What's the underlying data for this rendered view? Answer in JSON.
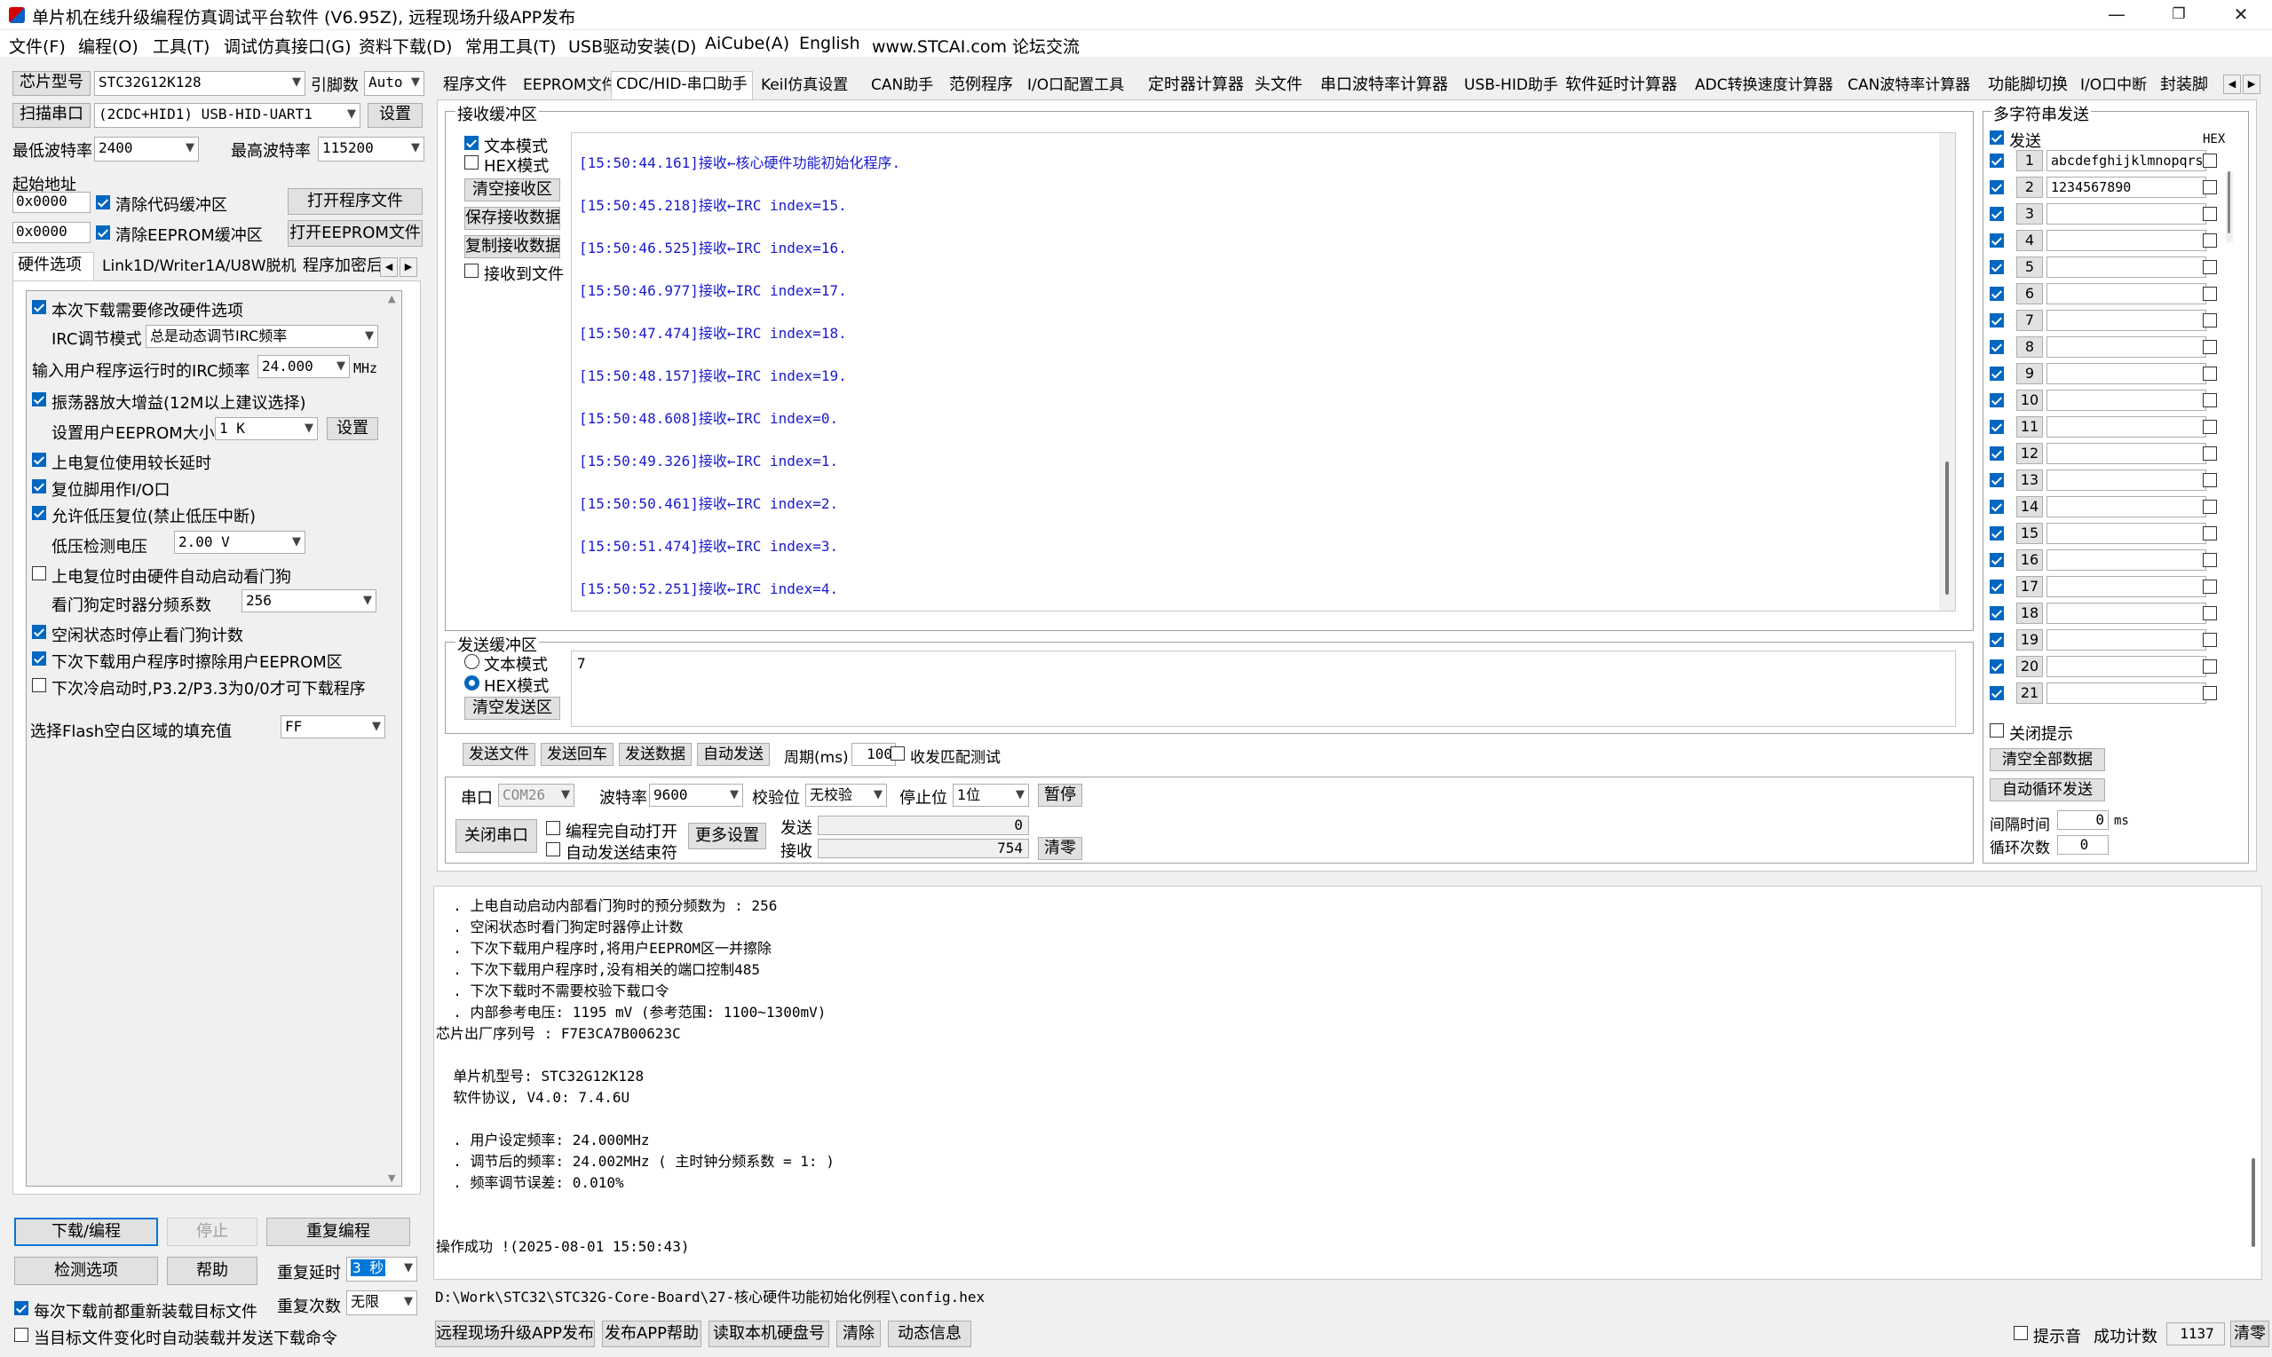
{
  "window": {
    "title": "单片机在线升级编程仿真调试平台软件 (V6.95Z), 远程现场升级APP发布",
    "min": "—",
    "max": "❐",
    "close": "✕"
  },
  "menu": [
    "文件(F)",
    "编程(O)",
    "工具(T)",
    "调试仿真接口(G)",
    "资料下载(D)",
    "常用工具(T)",
    "USB驱动安装(D)",
    "AiCube(A)",
    "English",
    "www.STCAI.com 论坛交流"
  ],
  "left": {
    "chip_label": "芯片型号",
    "chip_value": "STC32G12K128",
    "pins_label": "引脚数",
    "pins_value": "Auto",
    "scan_btn": "扫描串口",
    "port_value": "(2CDC+HID1) USB-HID-UART1",
    "set_btn": "设置",
    "min_baud_label": "最低波特率",
    "min_baud_value": "2400",
    "max_baud_label": "最高波特率",
    "max_baud_value": "115200",
    "start_addr_label": "起始地址",
    "addr1": "0x0000",
    "addr2": "0x0000",
    "clear_code_label": "清除代码缓冲区",
    "clear_eeprom_label": "清除EEPROM缓冲区",
    "open_prog_btn": "打开程序文件",
    "open_eeprom_btn": "打开EEPROM文件",
    "tabs": [
      "硬件选项",
      "Link1D/Writer1A/U8W脱机",
      "程序加密后"
    ],
    "hw": {
      "opt_modify": "本次下载需要修改硬件选项",
      "irc_mode_label": "IRC调节模式",
      "irc_mode_value": "总是动态调节IRC频率",
      "irc_freq_label": "输入用户程序运行时的IRC频率",
      "irc_freq_value": "24.000",
      "irc_freq_unit": "MHz",
      "osc_gain": "振荡器放大增益(12M以上建议选择)",
      "eeprom_size_label": "设置用户EEPROM大小",
      "eeprom_size_value": "1   K",
      "eeprom_set_btn": "设置",
      "long_delay": "上电复位使用较长延时",
      "reset_io": "复位脚用作I/O口",
      "lvr": "允许低压复位(禁止低压中断)",
      "lvd_label": "低压检测电压",
      "lvd_value": "2.00 V",
      "wdt_auto": "上电复位时由硬件自动启动看门狗",
      "wdt_div_label": "看门狗定时器分频系数",
      "wdt_div_value": "256",
      "idle_stop_wdt": "空闲状态时停止看门狗计数",
      "erase_eeprom": "下次下载用户程序时擦除用户EEPROM区",
      "p32_cold": "下次冷启动时,P3.2/P3.3为0/0才可下载程序",
      "flash_fill_label": "选择Flash空白区域的填充值",
      "flash_fill_value": "FF"
    },
    "download_btn": "下载/编程",
    "stop_btn": "停止",
    "reprogram_btn": "重复编程",
    "check_btn": "检测选项",
    "help_btn": "帮助",
    "repeat_delay_label": "重复延时",
    "repeat_delay_value": "3 秒",
    "repeat_count_label": "重复次数",
    "repeat_count_value": "无限",
    "reload_label": "每次下载前都重新装载目标文件",
    "auto_load_label": "当目标文件变化时自动装载并发送下载命令"
  },
  "tabs": [
    "程序文件",
    "EEPROM文件",
    "CDC/HID-串口助手",
    "Keil仿真设置",
    "CAN助手",
    "范例程序",
    "I/O口配置工具",
    "定时器计算器",
    "头文件",
    "串口波特率计算器",
    "USB-HID助手",
    "软件延时计算器",
    "ADC转换速度计算器",
    "CAN波特率计算器",
    "功能脚切换",
    "I/O口中断",
    "封装脚"
  ],
  "recv": {
    "group_label": "接收缓冲区",
    "text_mode": "文本模式",
    "hex_mode": "HEX模式",
    "clear_btn": "清空接收区",
    "save_btn": "保存接收数据",
    "copy_btn": "复制接收数据",
    "to_file": "接收到文件",
    "lines": [
      "[15:50:44.161]接收←核心硬件功能初始化程序.",
      "[15:50:45.218]接收←IRC index=15.",
      "[15:50:46.525]接收←IRC index=16.",
      "[15:50:46.977]接收←IRC index=17.",
      "[15:50:47.474]接收←IRC index=18.",
      "[15:50:48.157]接收←IRC index=19.",
      "[15:50:48.608]接收←IRC index=0.",
      "[15:50:49.326]接收←IRC index=1.",
      "[15:50:50.461]接收←IRC index=2.",
      "[15:50:51.474]接收←IRC index=3.",
      "[15:50:52.251]接收←IRC index=4."
    ]
  },
  "send": {
    "group_label": "发送缓冲区",
    "text_mode": "文本模式",
    "hex_mode": "HEX模式",
    "clear_btn": "清空发送区",
    "content": "7",
    "send_file_btn": "发送文件",
    "send_cr_btn": "发送回车",
    "send_data_btn": "发送数据",
    "auto_send_btn": "自动发送",
    "period_label": "周期(ms)",
    "period_value": "100",
    "match_test": "收发匹配测试"
  },
  "serial": {
    "port_label": "串口",
    "port_value": "COM26",
    "baud_label": "波特率",
    "baud_value": "9600",
    "parity_label": "校验位",
    "parity_value": "无校验",
    "stop_label": "停止位",
    "stop_value": "1位",
    "pause_btn": "暂停",
    "close_btn": "关闭串口",
    "auto_open": "编程完自动打开",
    "auto_end": "自动发送结束符",
    "more_btn": "更多设置",
    "tx_label": "发送",
    "tx_count": "0",
    "rx_label": "接收",
    "rx_count": "754",
    "clear_btn": "清零"
  },
  "multi": {
    "group_label": "多字符串发送",
    "send_label": "发送",
    "hex_label": "HEX",
    "rows": [
      {
        "n": "1",
        "v": "abcdefghijklmnopqrs"
      },
      {
        "n": "2",
        "v": "1234567890"
      },
      {
        "n": "3",
        "v": ""
      },
      {
        "n": "4",
        "v": ""
      },
      {
        "n": "5",
        "v": ""
      },
      {
        "n": "6",
        "v": ""
      },
      {
        "n": "7",
        "v": ""
      },
      {
        "n": "8",
        "v": ""
      },
      {
        "n": "9",
        "v": ""
      },
      {
        "n": "10",
        "v": ""
      },
      {
        "n": "11",
        "v": ""
      },
      {
        "n": "12",
        "v": ""
      },
      {
        "n": "13",
        "v": ""
      },
      {
        "n": "14",
        "v": ""
      },
      {
        "n": "15",
        "v": ""
      },
      {
        "n": "16",
        "v": ""
      },
      {
        "n": "17",
        "v": ""
      },
      {
        "n": "18",
        "v": ""
      },
      {
        "n": "19",
        "v": ""
      },
      {
        "n": "20",
        "v": ""
      },
      {
        "n": "21",
        "v": ""
      }
    ],
    "close_tip": "关闭提示",
    "clear_all_btn": "清空全部数据",
    "auto_loop_btn": "自动循环发送",
    "interval_label": "间隔时间",
    "interval_value": "0",
    "interval_unit": "ms",
    "loop_label": "循环次数",
    "loop_value": "0"
  },
  "log": {
    "lines": [
      "  . 上电自动启动内部看门狗时的预分频数为 : 256",
      "  . 空闲状态时看门狗定时器停止计数",
      "  . 下次下载用户程序时,将用户EEPROM区一并擦除",
      "  . 下次下载用户程序时,没有相关的端口控制485",
      "  . 下次下载时不需要校验下载口令",
      "  . 内部参考电压: 1195 mV (参考范围: 1100~1300mV)",
      "芯片出厂序列号 : F7E3CA7B00623C",
      "",
      "  单片机型号: STC32G12K128",
      "  软件协议, V4.0: 7.4.6U",
      "",
      "  . 用户设定频率: 24.000MHz",
      "  . 调节后的频率: 24.002MHz ( 主时钟分频系数 = 1: )",
      "  . 频率调节误差: 0.010%",
      "",
      "",
      "操作成功 !(2025-08-01 15:50:43)"
    ],
    "path": "D:\\Work\\STC32\\STC32G-Core-Board\\27-核心硬件功能初始化例程\\config.hex"
  },
  "status": {
    "remote_btn": "远程现场升级APP发布",
    "publish_help_btn": "发布APP帮助",
    "read_disk_btn": "读取本机硬盘号",
    "clear_btn": "清除",
    "dynamic_btn": "动态信息",
    "beep_label": "提示音",
    "success_label": "成功计数",
    "success_value": "1137",
    "reset_btn": "清零"
  }
}
